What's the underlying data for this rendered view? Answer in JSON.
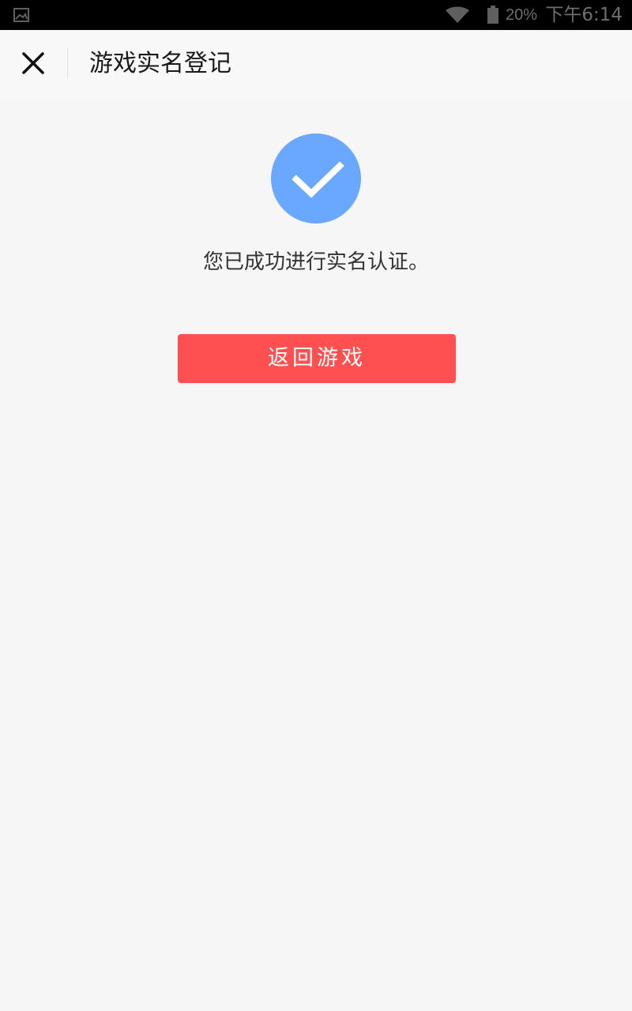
{
  "status_bar": {
    "battery_percent": "20%",
    "time": "下午6:14",
    "icons": [
      "gallery-icon",
      "wifi-icon",
      "battery-icon"
    ]
  },
  "header": {
    "title": "游戏实名登记",
    "close_icon": "close-icon"
  },
  "main": {
    "success_icon": "check-circle-icon",
    "message": "您已成功进行实名认证。",
    "return_button_label": "返回游戏"
  },
  "colors": {
    "background": "#f6f6f6",
    "header_background": "#f8f8f8",
    "success_icon": "#6aa8ff",
    "return_button": "#ff5051"
  }
}
